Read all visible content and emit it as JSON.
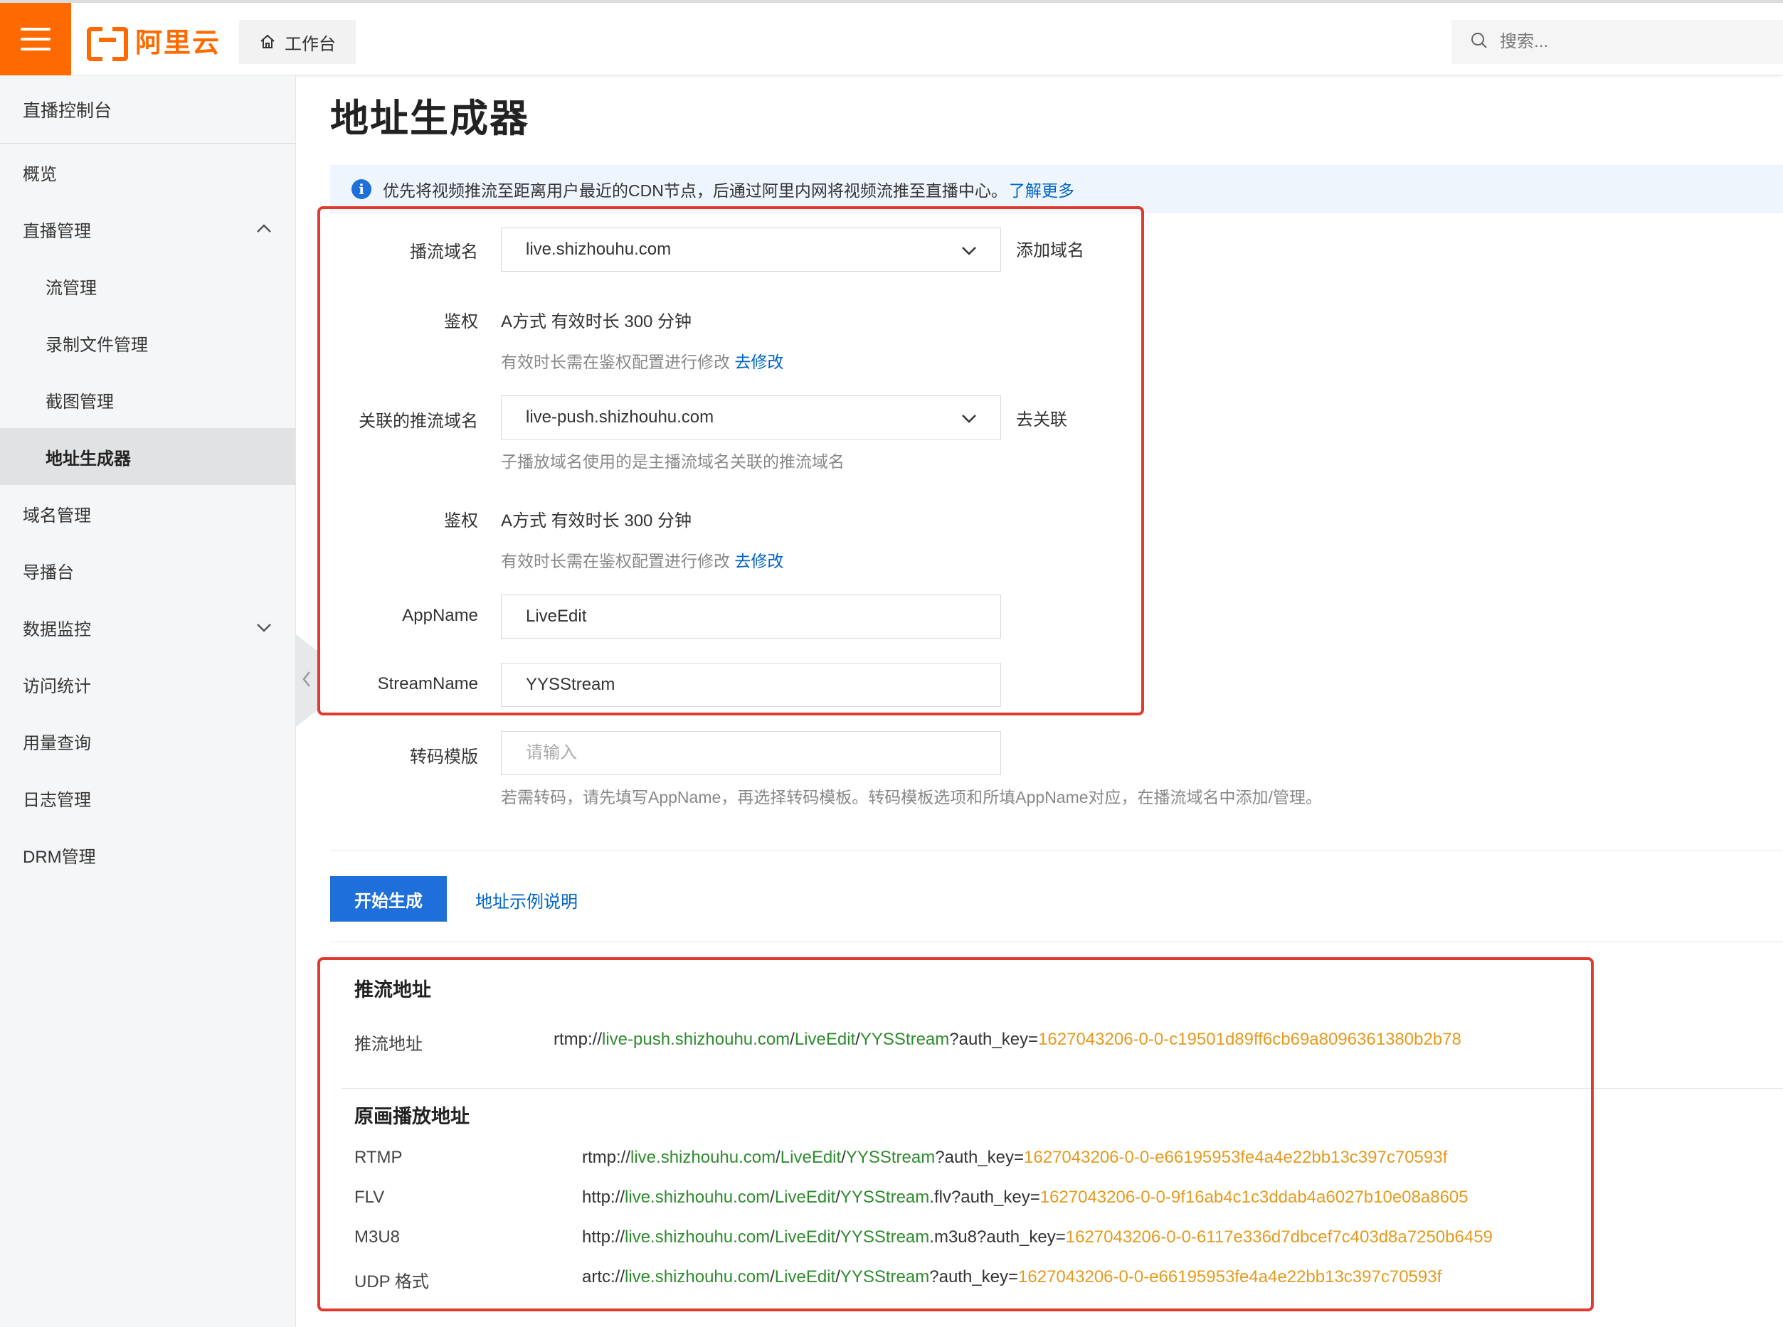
{
  "header": {
    "logo_text": "阿里云",
    "workbench_label": "工作台",
    "search_placeholder": "搜索..."
  },
  "sidebar": {
    "title": "直播控制台",
    "items": [
      {
        "label": "概览"
      },
      {
        "label": "直播管理"
      },
      {
        "label": "流管理"
      },
      {
        "label": "录制文件管理"
      },
      {
        "label": "截图管理"
      },
      {
        "label": "地址生成器"
      },
      {
        "label": "域名管理"
      },
      {
        "label": "导播台"
      },
      {
        "label": "数据监控"
      },
      {
        "label": "访问统计"
      },
      {
        "label": "用量查询"
      },
      {
        "label": "日志管理"
      },
      {
        "label": "DRM管理"
      }
    ]
  },
  "page": {
    "title": "地址生成器",
    "notice_text": "优先将视频推流至距离用户最近的CDN节点，后通过阿里内网将视频流推至直播中心。",
    "notice_link": "了解更多"
  },
  "form": {
    "play_domain_label": "播流域名",
    "play_domain_value": "live.shizhouhu.com",
    "add_domain_link": "添加域名",
    "auth1_label": "鉴权",
    "auth1_value": "A方式 有效时长 300 分钟",
    "auth1_hint": "有效时长需在鉴权配置进行修改",
    "auth1_link": "去修改",
    "push_domain_label": "关联的推流域名",
    "push_domain_value": "live-push.shizhouhu.com",
    "push_domain_link": "去关联",
    "push_domain_hint": "子播放域名使用的是主播流域名关联的推流域名",
    "auth2_label": "鉴权",
    "auth2_value": "A方式 有效时长 300 分钟",
    "auth2_hint": "有效时长需在鉴权配置进行修改",
    "auth2_link": "去修改",
    "appname_label": "AppName",
    "appname_value": "LiveEdit",
    "streamname_label": "StreamName",
    "streamname_value": "YYSStream",
    "template_label": "转码模版",
    "template_placeholder": "请输入",
    "template_hint": "若需转码，请先填写AppName，再选择转码模板。转码模板选项和所填AppName对应，在播流域名中添加/管理。"
  },
  "actions": {
    "generate_label": "开始生成",
    "example_link": "地址示例说明"
  },
  "results": {
    "push_section_title": "推流地址",
    "push_label": "推流地址",
    "push_url": {
      "prefix": "rtmp://",
      "host": "live-push.shizhouhu.com",
      "sep1": "/",
      "app": "LiveEdit",
      "sep2": "/",
      "stream": "YYSStream",
      "suffix": "?auth_key=",
      "key": "1627043206-0-0-c19501d89ff6cb69a8096361380b2b78"
    },
    "play_section_title": "原画播放地址",
    "play": [
      {
        "label": "RTMP",
        "prefix": "rtmp://",
        "host": "live.shizhouhu.com",
        "sep1": "/",
        "app": "LiveEdit",
        "sep2": "/",
        "stream": "YYSStream",
        "suffix": "?auth_key=",
        "key": "1627043206-0-0-e66195953fe4a4e22bb13c397c70593f"
      },
      {
        "label": "FLV",
        "prefix": "http://",
        "host": "live.shizhouhu.com",
        "sep1": "/",
        "app": "LiveEdit",
        "sep2": "/",
        "stream": "YYSStream",
        "suffix": ".flv?auth_key=",
        "key": "1627043206-0-0-9f16ab4c1c3ddab4a6027b10e08a8605"
      },
      {
        "label": "M3U8",
        "prefix": "http://",
        "host": "live.shizhouhu.com",
        "sep1": "/",
        "app": "LiveEdit",
        "sep2": "/",
        "stream": "YYSStream",
        "suffix": ".m3u8?auth_key=",
        "key": "1627043206-0-0-6117e336d7dbcef7c403d8a7250b6459"
      },
      {
        "label": "UDP 格式",
        "prefix": "artc://",
        "host": "live.shizhouhu.com",
        "sep1": "/",
        "app": "LiveEdit",
        "sep2": "/",
        "stream": "YYSStream",
        "suffix": "?auth_key=",
        "key": "1627043206-0-0-e66195953fe4a4e22bb13c397c70593f"
      }
    ]
  },
  "colors": {
    "brand": "#ff6a00",
    "primary": "#1e6fd9",
    "link": "#0064c8",
    "highlight_box": "#e03a2e",
    "url_host": "#2e8b2e",
    "url_key": "#e59a1f"
  }
}
